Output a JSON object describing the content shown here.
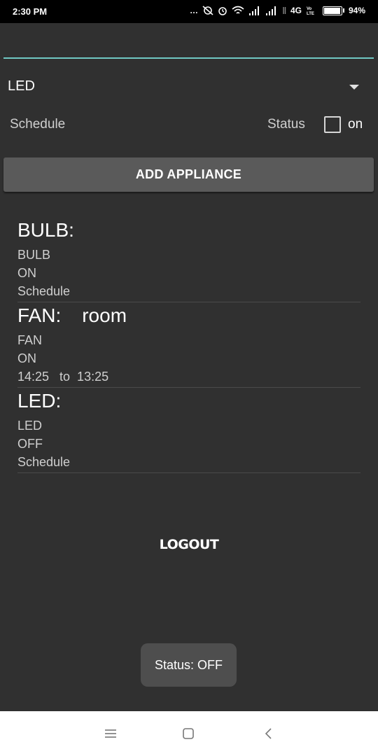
{
  "status_bar": {
    "time": "2:30 PM",
    "network": "4G",
    "battery_percent": "94%",
    "battery_level": 0.94
  },
  "form": {
    "name_input_value": "",
    "spinner_value": "LED",
    "schedule_label": "Schedule",
    "status_label": "Status",
    "checkbox_label": "on",
    "checkbox_checked": false,
    "add_button_label": "ADD APPLIANCE"
  },
  "appliances": [
    {
      "title": "BULB:",
      "location": "",
      "type": "BULB",
      "state": "ON",
      "schedule": "Schedule"
    },
    {
      "title": "FAN:",
      "location": "room",
      "type": "FAN",
      "state": "ON",
      "schedule": "14:25   to  13:25"
    },
    {
      "title": "LED:",
      "location": "",
      "type": "LED",
      "state": "OFF",
      "schedule": "Schedule"
    }
  ],
  "logout_label": "LOGOUT",
  "toast": "Status: OFF",
  "colors": {
    "background": "#303030",
    "accent": "#6fc8c3",
    "button": "#5a5a5a"
  },
  "nav_icons": [
    "menu-icon",
    "home-icon",
    "back-icon"
  ]
}
